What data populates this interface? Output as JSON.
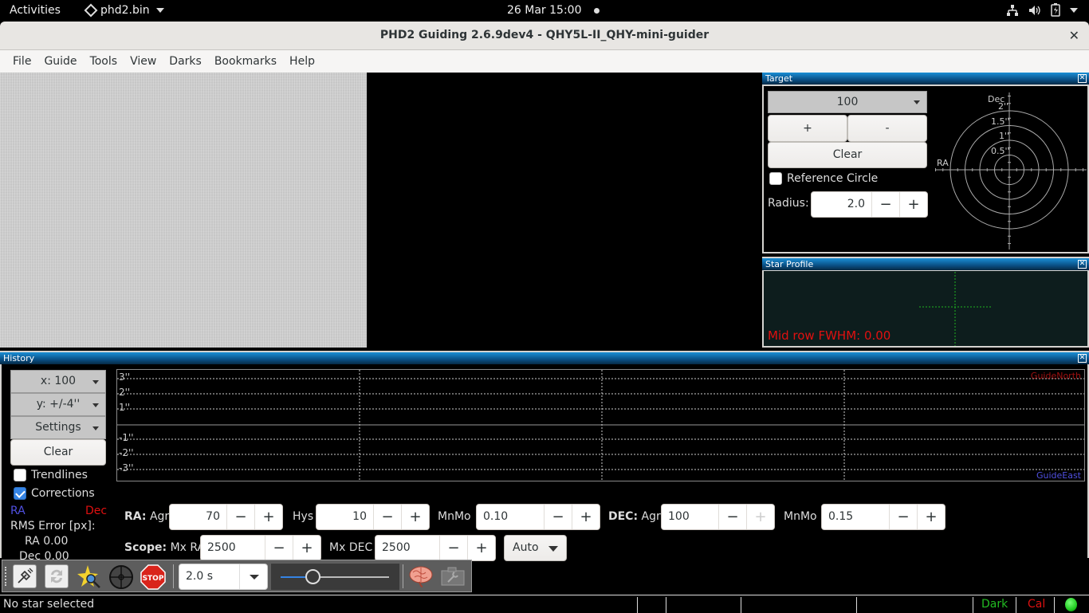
{
  "topbar": {
    "activities": "Activities",
    "app_name": "phd2.bin",
    "clock": "26 Mar  15:00",
    "tray_icons": [
      "network-icon",
      "volume-icon",
      "battery-icon",
      "chevron-down-icon"
    ]
  },
  "window": {
    "title": "PHD2 Guiding 2.6.9dev4 - QHY5L-II_QHY-mini-guider",
    "close": "✕"
  },
  "menu": [
    "File",
    "Guide",
    "Tools",
    "View",
    "Darks",
    "Bookmarks",
    "Help"
  ],
  "target_panel": {
    "title": "Target",
    "length_select": "100",
    "zoom_in": "+",
    "zoom_out": "-",
    "clear": "Clear",
    "reference_circle_label": "Reference Circle",
    "reference_circle_checked": false,
    "radius_label": "Radius:",
    "radius_value": "2.0",
    "minus": "−",
    "plus": "+",
    "axis_ra": "RA",
    "axis_dec": "Dec",
    "ring_labels": [
      "0.5''",
      "1''",
      "1.5''",
      "2''"
    ]
  },
  "star_profile": {
    "title": "Star Profile",
    "fwhm_text": "Mid row FWHM: 0.00",
    "fwhm_color": "#e01010"
  },
  "history": {
    "title": "History",
    "x_select": "x: 100",
    "y_select": "y: +/-4''",
    "settings_select": "Settings",
    "clear": "Clear",
    "trendlines_label": "Trendlines",
    "trendlines_checked": false,
    "corrections_label": "Corrections",
    "corrections_checked": true,
    "legend_ra": "RA",
    "legend_dec": "Dec",
    "ra_color": "#5050e0",
    "dec_color": "#e01010",
    "rms_title": "RMS Error [px]:",
    "rms_ra": "RA 0.00",
    "rms_dec": "Dec 0.00",
    "graph": {
      "y_labels": [
        "3''",
        "2''",
        "1''",
        "-1''",
        "-2''",
        "-3''"
      ],
      "guide_north": "GuideNorth",
      "guide_east": "GuideEast"
    },
    "ra_label": "RA:",
    "agr_label": "Agr",
    "ra_agr": "70",
    "hys_label": "Hys",
    "ra_hys": "10",
    "mnmo_label": "MnMo",
    "ra_mnmo": "0.10",
    "dec_label": "DEC:",
    "dec_agr": "100",
    "dec_mnmo": "0.15",
    "scope_label": "Scope:",
    "mxra_label": "Mx RA",
    "mx_ra": "2500",
    "mxdec_label": "Mx DEC",
    "mx_dec": "2500",
    "dec_mode": "Auto",
    "minus": "−",
    "plus": "+"
  },
  "toolbar": {
    "exposure": "2.0 s",
    "gamma_fraction": 0.3,
    "buttons": [
      "connect-gear",
      "loop",
      "auto-select-star",
      "guide",
      "stop",
      "brain",
      "camera-settings"
    ]
  },
  "status": {
    "message": "No star selected",
    "dark": "Dark",
    "dark_color": "#22bb22",
    "cal": "Cal",
    "cal_color": "#dd1111",
    "connected_color": "#22cc22"
  }
}
